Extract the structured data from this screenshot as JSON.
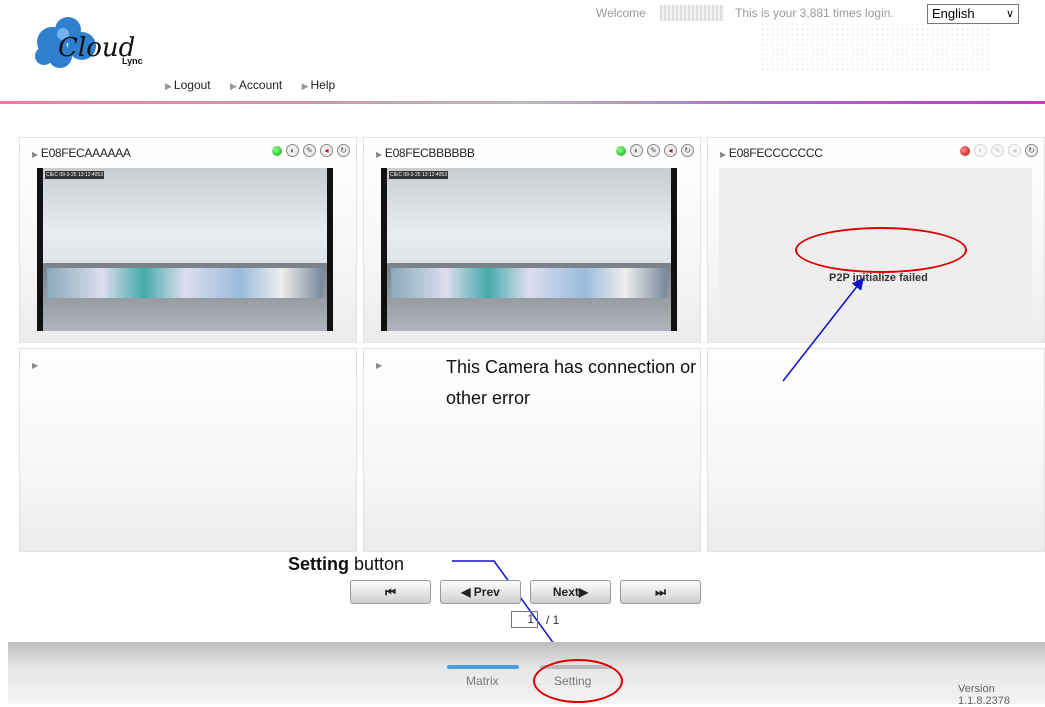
{
  "header": {
    "brand": "Cloud",
    "brand_sub": "Lync",
    "welcome": "Welcome",
    "login_text": "This is your 3,881 times login.",
    "language": "English",
    "nav": [
      "Logout",
      "Account",
      "Help"
    ]
  },
  "cameras": [
    {
      "id": "E08FECAAAAAA",
      "status": "online",
      "osd": "CIEC 09-3-25 13:12:4053"
    },
    {
      "id": "E08FECBBBBBB",
      "status": "online",
      "osd": "CIEC 09-3-25 13:12:4053"
    },
    {
      "id": "E08FECCCCCCC",
      "status": "error",
      "error": "P2P initialize failed"
    }
  ],
  "annotations": {
    "error_note_line1": "This Camera has connection or",
    "error_note_line2": "other error",
    "setting_note_bold": "Setting",
    "setting_note_rest": " button"
  },
  "pager": {
    "first": "⏮",
    "prev": "◀ Prev",
    "next": "Next▶",
    "last": "⏭",
    "current_page": "1",
    "total": "/ 1"
  },
  "footer": {
    "tab_matrix": "Matrix",
    "tab_setting": "Setting",
    "version": "Version 1.1.8.2378"
  },
  "colors": {
    "online": "#22aa22",
    "error": "#cc1111",
    "annotation_red": "#dd0000",
    "annotation_blue": "#1111cc"
  }
}
